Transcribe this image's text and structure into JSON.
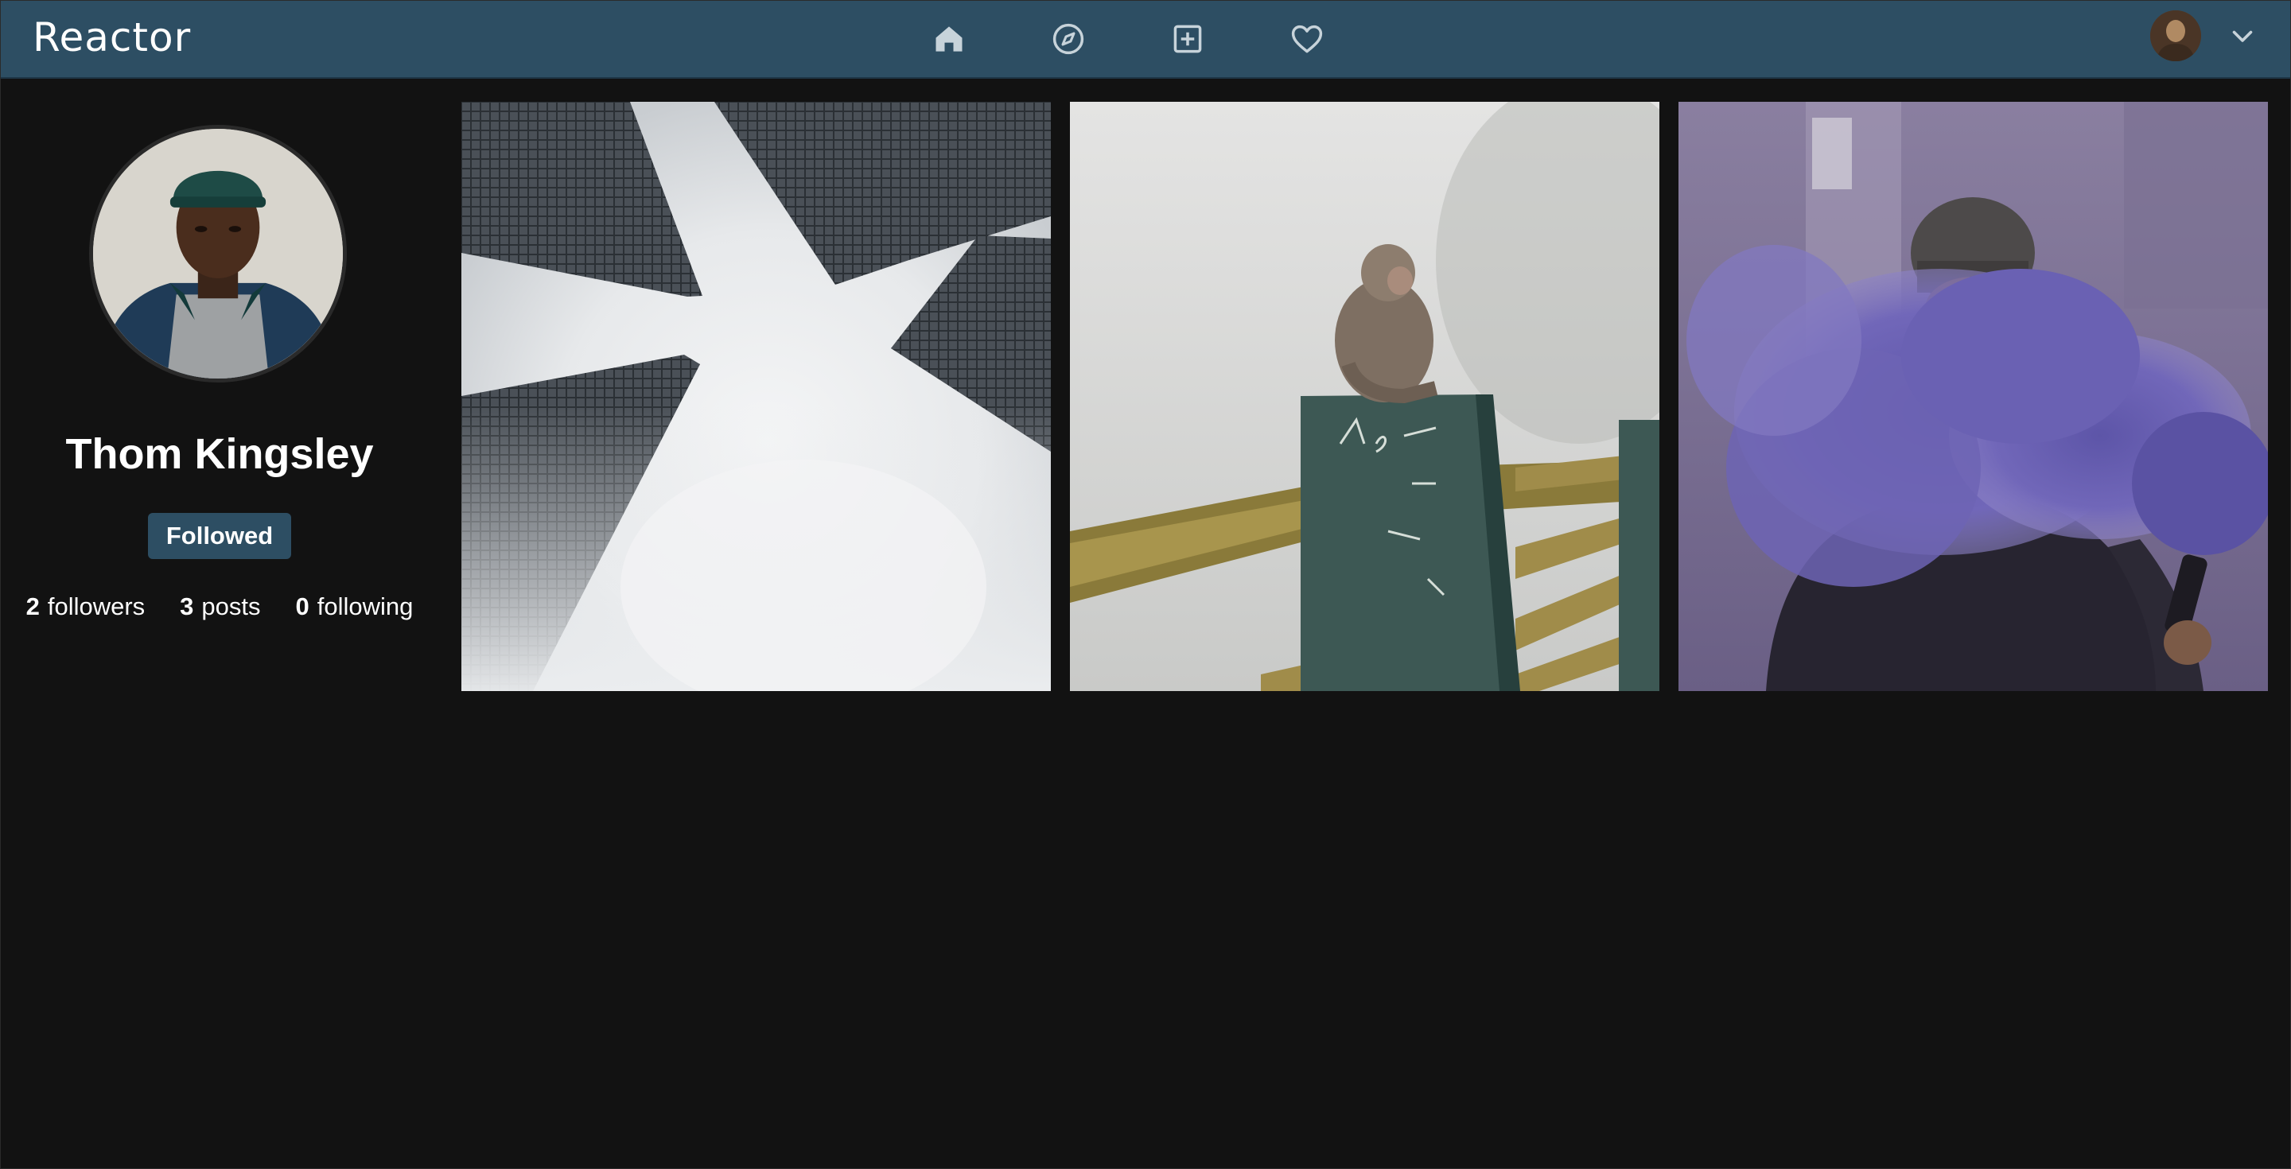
{
  "app": {
    "logo": "Reactor"
  },
  "nav": {
    "items": [
      {
        "icon": "home-icon"
      },
      {
        "icon": "compass-icon"
      },
      {
        "icon": "add-post-icon"
      },
      {
        "icon": "heart-icon"
      }
    ],
    "user_menu_icon": "chevron-down-icon"
  },
  "profile": {
    "name": "Thom Kingsley",
    "follow_button_label": "Followed",
    "stats": {
      "followers_count": "2",
      "followers_label": "followers",
      "posts_count": "3",
      "posts_label": "posts",
      "following_count": "0",
      "following_label": "following"
    }
  },
  "posts": [
    {
      "subject": "foggy skyscrapers"
    },
    {
      "subject": "monkey on fence post"
    },
    {
      "subject": "person with purple smoke"
    }
  ],
  "colors": {
    "topbar": "#2d4e63",
    "background": "#121212",
    "button": "#2d4e63"
  }
}
